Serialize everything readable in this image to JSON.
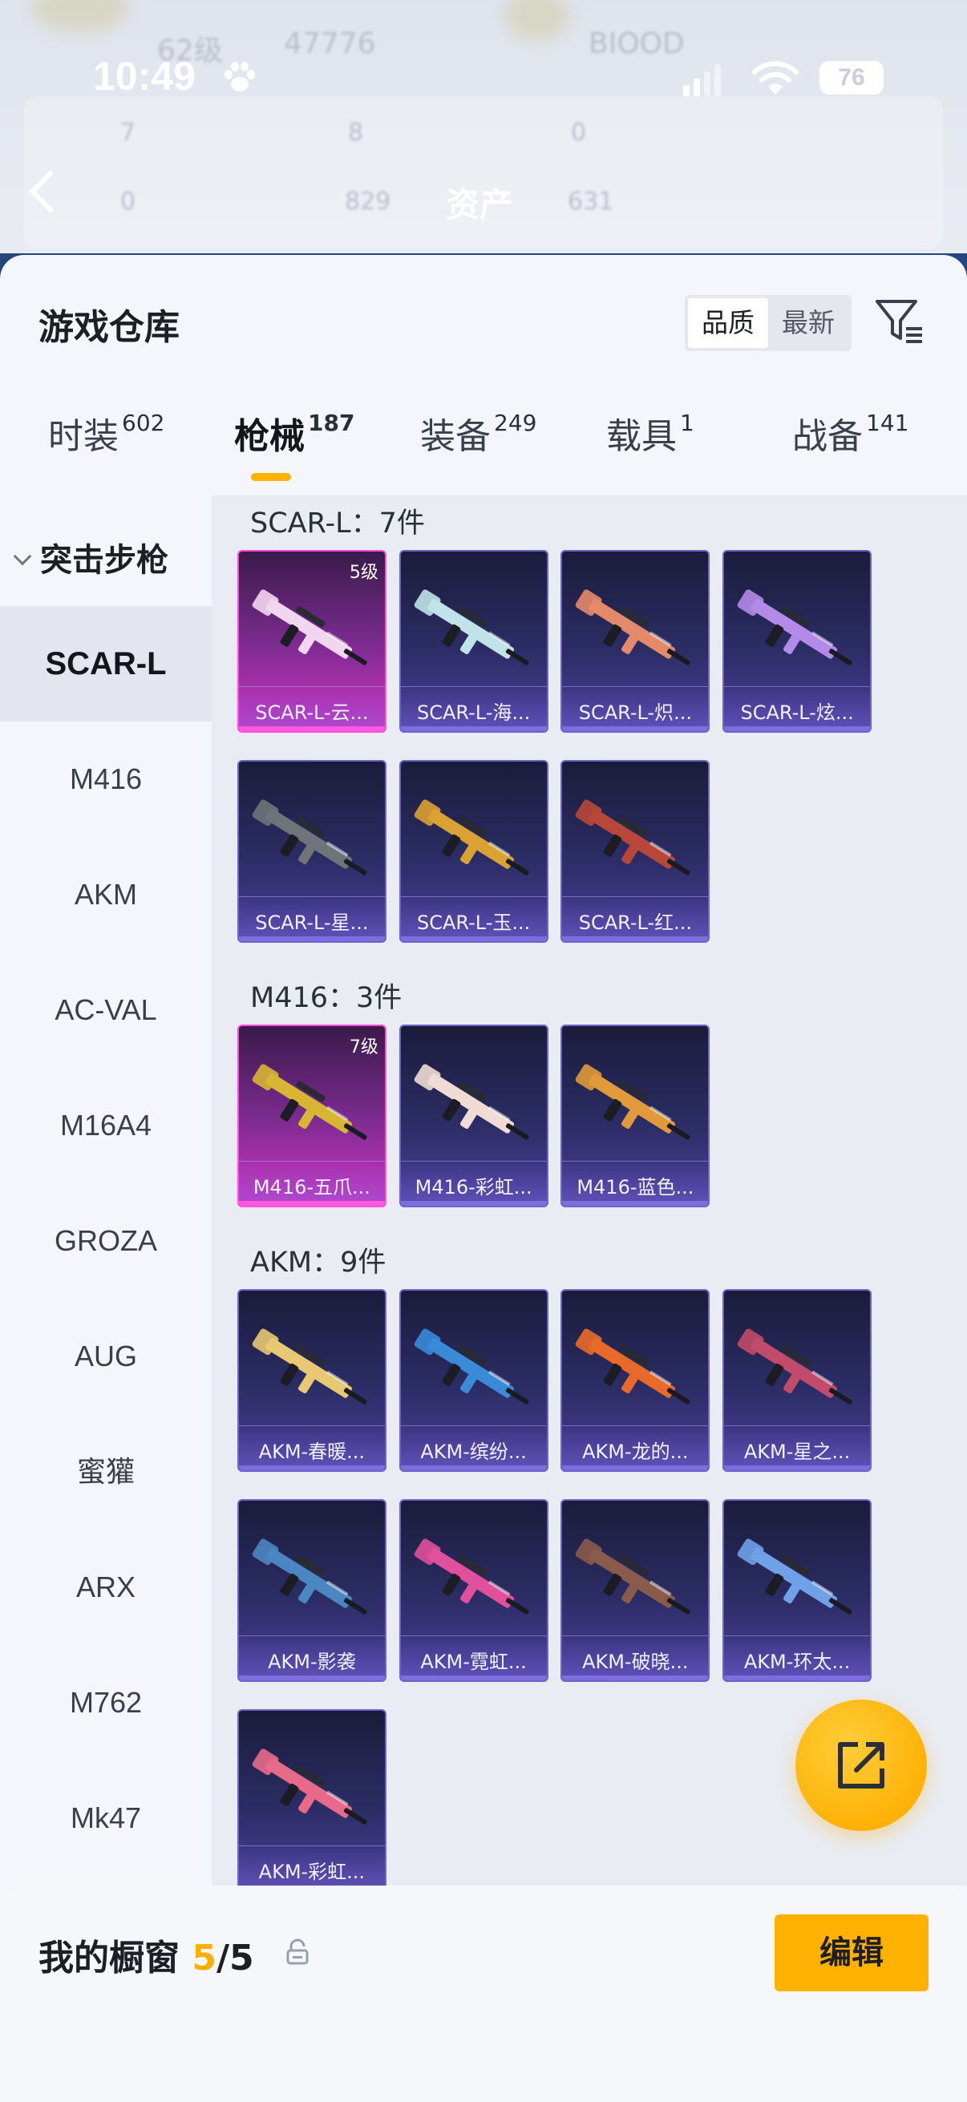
{
  "background": {
    "faded_texts": [
      "62级",
      "47776",
      "BIOOD",
      "7",
      "8",
      "0",
      "0",
      "829",
      "631"
    ],
    "title": "资产"
  },
  "status_bar": {
    "time": "10:49",
    "battery": "76"
  },
  "sheet": {
    "title": "游戏仓库",
    "sort_options": [
      "品质",
      "最新"
    ],
    "sort_active": "品质"
  },
  "tabs": [
    {
      "label": "时装",
      "count": "602"
    },
    {
      "label": "枪械",
      "count": "187"
    },
    {
      "label": "装备",
      "count": "249"
    },
    {
      "label": "载具",
      "count": "1"
    },
    {
      "label": "战备",
      "count": "141"
    }
  ],
  "sidebar": {
    "header": "突击步枪",
    "items": [
      "SCAR-L",
      "M416",
      "AKM",
      "AC-VAL",
      "M16A4",
      "GROZA",
      "AUG",
      "蜜獾",
      "ARX",
      "M762",
      "Mk47"
    ]
  },
  "groups": [
    {
      "title": "SCAR-L：7件",
      "items": [
        {
          "name": "SCAR-L-云...",
          "level": "5级",
          "rarity": "pink",
          "skin": "#f2d6f0"
        },
        {
          "name": "SCAR-L-海...",
          "rarity": "purple",
          "skin": "#bfe3e8"
        },
        {
          "name": "SCAR-L-炽...",
          "rarity": "purple",
          "skin": "#e48a6a"
        },
        {
          "name": "SCAR-L-炫...",
          "rarity": "purple",
          "skin": "#b48ae8"
        },
        {
          "name": "SCAR-L-星...",
          "rarity": "purple",
          "skin": "#6f7478"
        },
        {
          "name": "SCAR-L-玉...",
          "rarity": "purple",
          "skin": "#d9a232"
        },
        {
          "name": "SCAR-L-红...",
          "rarity": "purple",
          "skin": "#b8473a"
        }
      ]
    },
    {
      "title": "M416：3件",
      "items": [
        {
          "name": "M416-五爪...",
          "level": "7级",
          "rarity": "pink",
          "skin": "#d8b532"
        },
        {
          "name": "M416-彩虹...",
          "rarity": "purple",
          "skin": "#f0dcd4"
        },
        {
          "name": "M416-蓝色...",
          "rarity": "purple",
          "skin": "#e09a3a"
        }
      ]
    },
    {
      "title": "AKM：9件",
      "items": [
        {
          "name": "AKM-春暖...",
          "rarity": "purple",
          "skin": "#e8c872"
        },
        {
          "name": "AKM-缤纷...",
          "rarity": "purple",
          "skin": "#3a8ad8"
        },
        {
          "name": "AKM-龙的...",
          "rarity": "purple",
          "skin": "#e86a2a"
        },
        {
          "name": "AKM-星之...",
          "rarity": "purple",
          "skin": "#c24a6a"
        },
        {
          "name": "AKM-影袭",
          "rarity": "purple",
          "skin": "#4a86c2"
        },
        {
          "name": "AKM-霓虹...",
          "rarity": "purple",
          "skin": "#e0509c"
        },
        {
          "name": "AKM-破晓...",
          "rarity": "purple",
          "skin": "#8a5a4a"
        },
        {
          "name": "AKM-环太...",
          "rarity": "purple",
          "skin": "#6fa0e8"
        },
        {
          "name": "AKM-彩虹...",
          "rarity": "purple",
          "skin": "#e86a8a"
        }
      ]
    }
  ],
  "bottom_bar": {
    "label": "我的橱窗",
    "current": "5",
    "total": "/5",
    "edit_label": "编辑"
  },
  "colors": {
    "accent": "#ffb100",
    "pink_rarity": "#ff4fd8",
    "purple_rarity": "#6f63c8"
  }
}
